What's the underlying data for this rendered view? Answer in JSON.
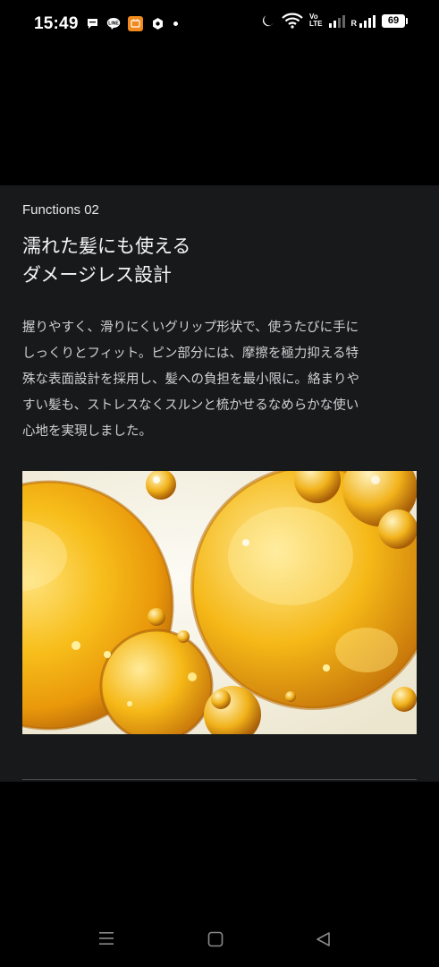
{
  "status_bar": {
    "time": "15:49",
    "volte_top": "Vo",
    "volte_bottom": "LTE",
    "roaming_label": "R",
    "battery": "69"
  },
  "section": {
    "label": "Functions 02",
    "heading_line1": "濡れた髪にも使える",
    "heading_line2": "ダメージレス設計",
    "body_lines": [
      "握りやすく、滑りにくいグリップ形状で、使うたびに手に",
      "しっくりとフィット。ピン部分には、摩擦を極力抑える特",
      "殊な表面設計を採用し、髪への負担を最小限に。絡まりや",
      "すい髪も、ストレスなくスルンと梳かせるなめらかな使い",
      "心地を実現しました。"
    ]
  },
  "image": {
    "subject": "golden-oil-bubbles"
  },
  "icons": [
    "chat-icon",
    "line-icon",
    "app-icon",
    "gear-icon",
    "moon-icon",
    "wifi-icon",
    "signal-icon",
    "battery-icon",
    "menu-icon",
    "home-icon",
    "back-icon"
  ],
  "colors": {
    "background": "#000000",
    "card": "#17191b",
    "oil_gold": "#f2b10c"
  }
}
